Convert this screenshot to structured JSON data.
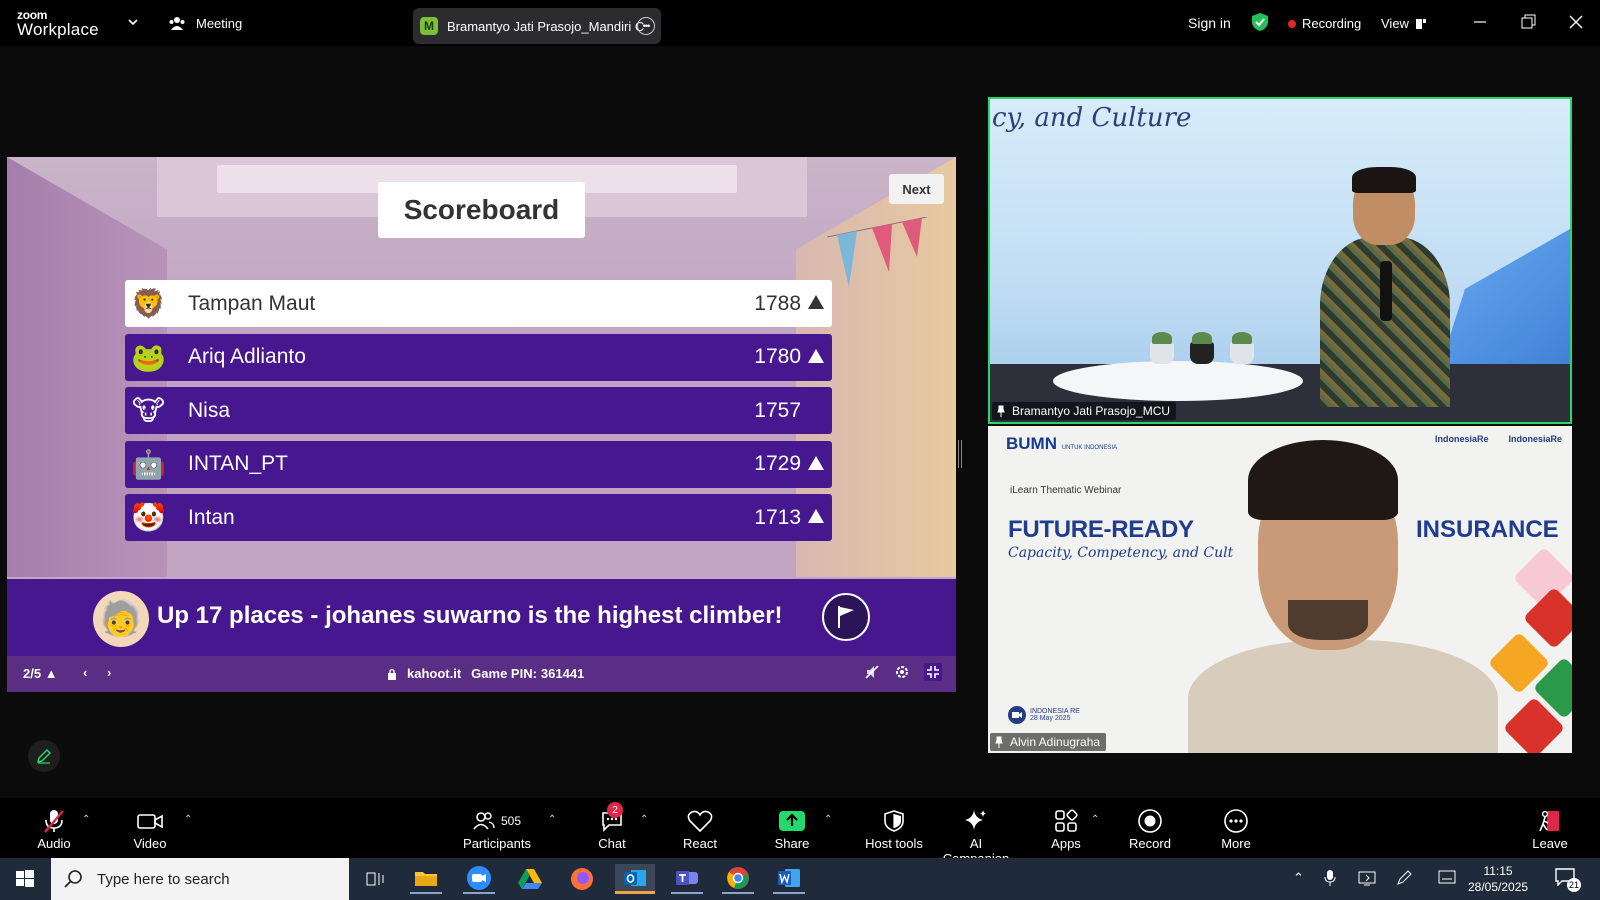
{
  "app": {
    "logo_small": "zoom",
    "logo_big": "Workplace",
    "meeting_label": "Meeting",
    "share_pill": {
      "badge": "M",
      "title": "Bramantyo Jati Prasojo_Mandiri C"
    },
    "sign_in": "Sign in",
    "recording": "Recording",
    "view": "View"
  },
  "kahoot": {
    "title": "Scoreboard",
    "next_label": "Next",
    "players": [
      {
        "name": "Tampan Maut",
        "score": "1788",
        "avatar": "🦁",
        "up": true
      },
      {
        "name": "Ariq Adlianto",
        "score": "1780",
        "avatar": "🐸",
        "up": true
      },
      {
        "name": "Nisa",
        "score": "1757",
        "avatar": "🐮",
        "up": false
      },
      {
        "name": "INTAN_PT",
        "score": "1729",
        "avatar": "🤖",
        "up": true
      },
      {
        "name": "Intan",
        "score": "1713",
        "avatar": "🤡",
        "up": true
      }
    ],
    "climber": {
      "prefix": "Up ",
      "count": "17",
      "suffix": " places - johanes suwarno is the highest climber!"
    },
    "footer": {
      "page": "2/5",
      "site": "kahoot.it",
      "pin_label": "Game PIN:",
      "pin": "361441"
    }
  },
  "videos": {
    "top": {
      "name": "Bramantyo Jati Prasojo_MCU",
      "backdrop_text": "cy, and Culture"
    },
    "bottom": {
      "name": "Alvin Adinugraha",
      "bumn": "BUMN",
      "bumn_sub": "UNTUK INDONESIA",
      "logo1": "IndonesiaRe",
      "logo2": "IndonesiaRe",
      "webinar": "iLearn Thematic Webinar",
      "title_left": "FUTURE-READY",
      "title_right": "INSURANCE",
      "subtitle": "Capacity, Competency, and Cult",
      "date_org": "INDONESIA RE",
      "date": "28 May 2025"
    }
  },
  "toolbar": {
    "audio": "Audio",
    "video": "Video",
    "participants": "Participants",
    "participants_count": "505",
    "chat": "Chat",
    "chat_badge": "2",
    "react": "React",
    "share": "Share",
    "host_tools": "Host tools",
    "ai_companion": "AI Companion",
    "apps": "Apps",
    "record": "Record",
    "more": "More",
    "leave": "Leave"
  },
  "taskbar": {
    "search_placeholder": "Type here to search",
    "time": "11:15",
    "date": "28/05/2025",
    "notifications": "21"
  },
  "colors": {
    "kahoot_purple": "#46178f",
    "active_speaker_border": "#23d96c",
    "recording_dot": "#e02828",
    "share_green": "#23d96c"
  }
}
